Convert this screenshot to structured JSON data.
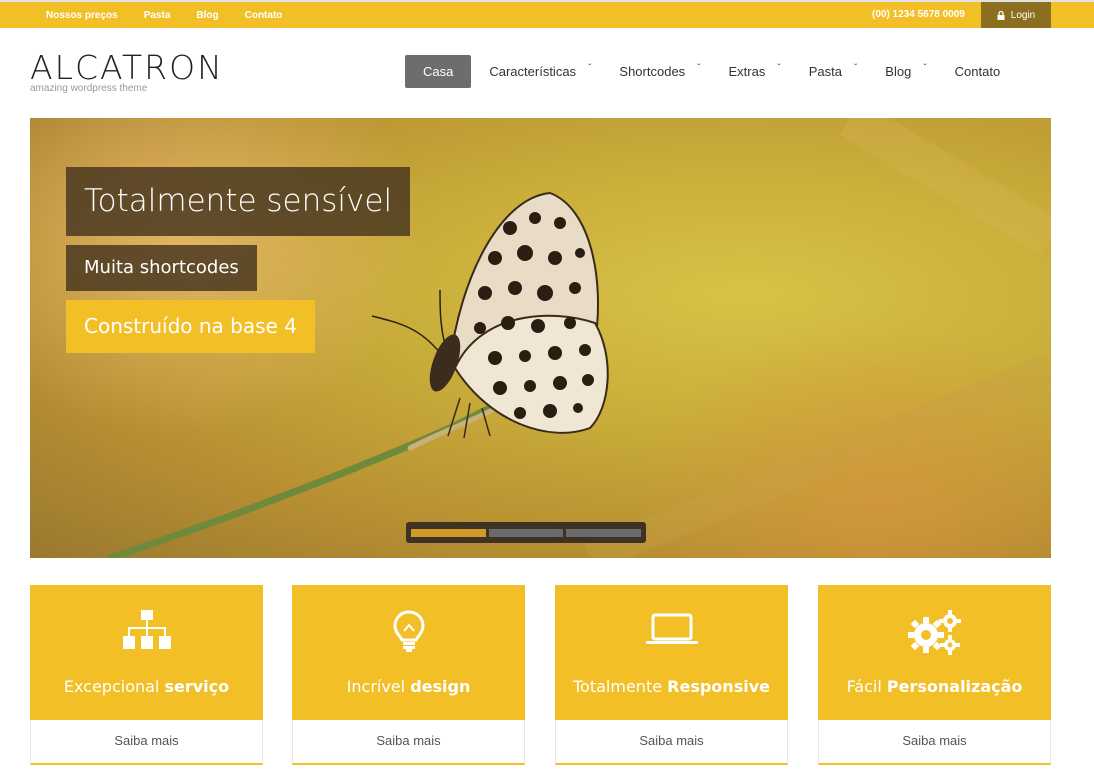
{
  "topbar": {
    "links": [
      "Nossos preços",
      "Pasta",
      "Blog",
      "Contato"
    ],
    "phone": "(00) 1234 5678 0009",
    "login": "Login"
  },
  "logo": {
    "name": "ALCATRON",
    "tagline": "amazing wordpress theme"
  },
  "nav": {
    "items": [
      {
        "label": "Casa"
      },
      {
        "label": "Características"
      },
      {
        "label": "Shortcodes"
      },
      {
        "label": "Extras"
      },
      {
        "label": "Pasta"
      },
      {
        "label": "Blog"
      },
      {
        "label": "Contato"
      }
    ]
  },
  "slider": {
    "captions": [
      "Totalmente sensível",
      "Muita shortcodes",
      "Construído na base 4"
    ],
    "active_slide": 1,
    "slide_count": 3
  },
  "features": [
    {
      "icon": "sitemap-icon",
      "title_light": "Excepcional",
      "title_bold": "serviço",
      "more": "Saiba mais"
    },
    {
      "icon": "lightbulb-icon",
      "title_light": "Incrível",
      "title_bold": "design",
      "more": "Saiba mais"
    },
    {
      "icon": "laptop-icon",
      "title_light": "Totalmente",
      "title_bold": "Responsive",
      "more": "Saiba mais"
    },
    {
      "icon": "gears-icon",
      "title_light": "Fácil",
      "title_bold": "Personalização",
      "more": "Saiba mais"
    }
  ],
  "colors": {
    "accent": "#f2bf27",
    "nav_active": "#6d6d6d",
    "login_bg": "#8b6f1e"
  }
}
